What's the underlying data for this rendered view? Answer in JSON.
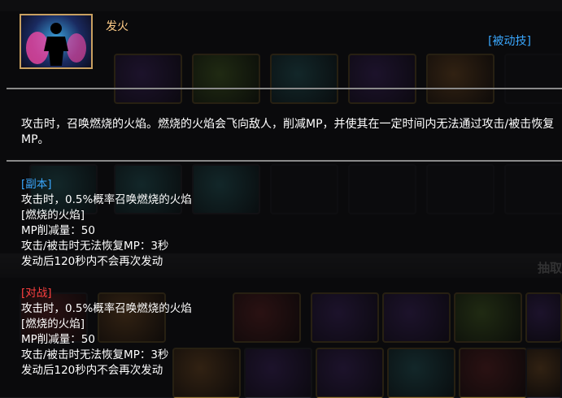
{
  "skill": {
    "name": "发火",
    "type": "[被动技]",
    "description": "攻击时，召唤燃烧的火焰。燃烧的火焰会飞向敌人，削减MP，并使其在一定时间内无法通过攻击/被击恢复MP。"
  },
  "dungeon": {
    "tag": "[副本]",
    "lines": [
      "攻击时，0.5%概率召唤燃烧的火焰",
      "[燃烧的火焰]",
      "MP削减量：50",
      "攻击/被击时无法恢复MP：3秒",
      "发动后120秒内不会再次发动"
    ]
  },
  "pvp": {
    "tag": "[对战]",
    "lines": [
      "攻击时，0.5%概率召唤燃烧的火焰",
      "[燃烧的火焰]",
      "MP削减量：50",
      "攻击/被击时无法恢复MP：3秒",
      "发动后120秒内不会再次发动"
    ]
  },
  "background": {
    "side_button": "抽取"
  }
}
